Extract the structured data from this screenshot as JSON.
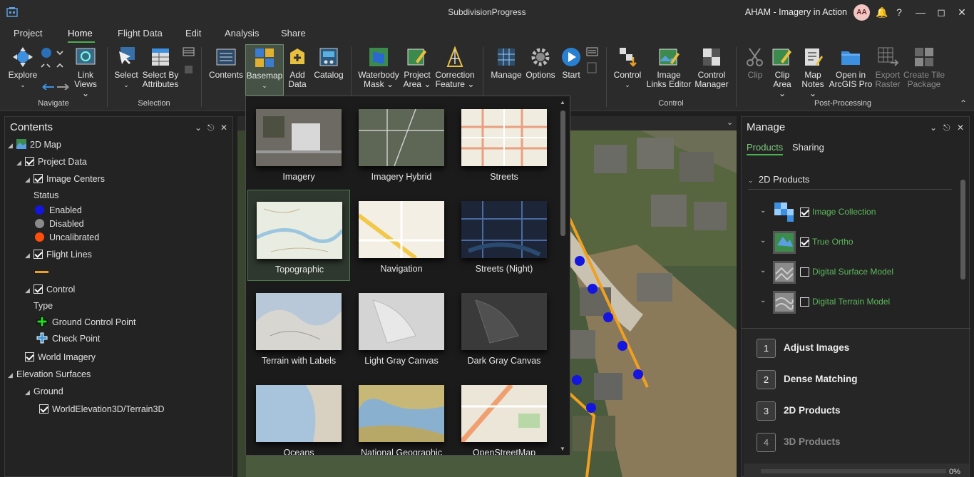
{
  "titlebar": {
    "doc_title": "SubdivisionProgress",
    "project_title": "AHAM - Imagery in Action",
    "avatar_initials": "AA"
  },
  "tabs": [
    "Project",
    "Home",
    "Flight Data",
    "Edit",
    "Analysis",
    "Share"
  ],
  "ribbon": {
    "navigate": {
      "label": "Navigate",
      "explore": "Explore",
      "link_views": "Link Views"
    },
    "selection": {
      "label": "Selection",
      "select": "Select",
      "select_by_attributes": "Select By Attributes"
    },
    "layer": {
      "contents": "Contents",
      "basemap": "Basemap",
      "add_data": "Add Data",
      "catalog": "Catalog"
    },
    "masks": {
      "waterbody_mask": "Waterbody Mask",
      "project_area": "Project Area",
      "correction_feature": "Correction Feature"
    },
    "manage": {
      "manage": "Manage",
      "options": "Options",
      "start": "Start"
    },
    "control": {
      "label": "Control",
      "control": "Control",
      "image_links_editor": "Image Links Editor",
      "control_manager": "Control Manager"
    },
    "post": {
      "label": "Post-Processing",
      "clip": "Clip",
      "clip_area": "Clip Area",
      "map_notes": "Map Notes",
      "open_in_pro": "Open in ArcGIS Pro",
      "export_raster": "Export Raster",
      "create_tile_package": "Create Tile Package"
    }
  },
  "contents": {
    "title": "Contents",
    "map_name": "2D Map",
    "project_data": "Project Data",
    "image_centers": "Image Centers",
    "status_label": "Status",
    "enabled": "Enabled",
    "disabled": "Disabled",
    "uncalibrated": "Uncalibrated",
    "flight_lines": "Flight Lines",
    "control": "Control",
    "type_label": "Type",
    "gcp": "Ground Control Point",
    "check_point": "Check Point",
    "world_imagery": "World Imagery",
    "elevation_surfaces": "Elevation Surfaces",
    "ground": "Ground",
    "world_elevation": "WorldElevation3D/Terrain3D",
    "colors": {
      "enabled": "#1515e0",
      "disabled": "#8a8a8a",
      "uncalibrated": "#ff4d0a",
      "flight_line": "#f0a020"
    }
  },
  "basemaps": [
    {
      "label": "Imagery"
    },
    {
      "label": "Imagery Hybrid"
    },
    {
      "label": "Streets"
    },
    {
      "label": "Topographic"
    },
    {
      "label": "Navigation"
    },
    {
      "label": "Streets (Night)"
    },
    {
      "label": "Terrain with Labels"
    },
    {
      "label": "Light Gray Canvas"
    },
    {
      "label": "Dark Gray Canvas"
    },
    {
      "label": "Oceans"
    },
    {
      "label": "National Geographic"
    },
    {
      "label": "OpenStreetMap"
    }
  ],
  "manage_pane": {
    "title": "Manage",
    "tabs": [
      "Products",
      "Sharing"
    ],
    "section": "2D Products",
    "products": [
      {
        "name": "Image Collection",
        "checked": true
      },
      {
        "name": "True Ortho",
        "checked": true
      },
      {
        "name": "Digital Surface Model",
        "checked": false
      },
      {
        "name": "Digital Terrain Model",
        "checked": false
      }
    ],
    "steps": [
      {
        "num": "1",
        "label": "Adjust Images"
      },
      {
        "num": "2",
        "label": "Dense Matching"
      },
      {
        "num": "3",
        "label": "2D Products"
      },
      {
        "num": "4",
        "label": "3D Products"
      }
    ],
    "progress_text": "0%"
  }
}
